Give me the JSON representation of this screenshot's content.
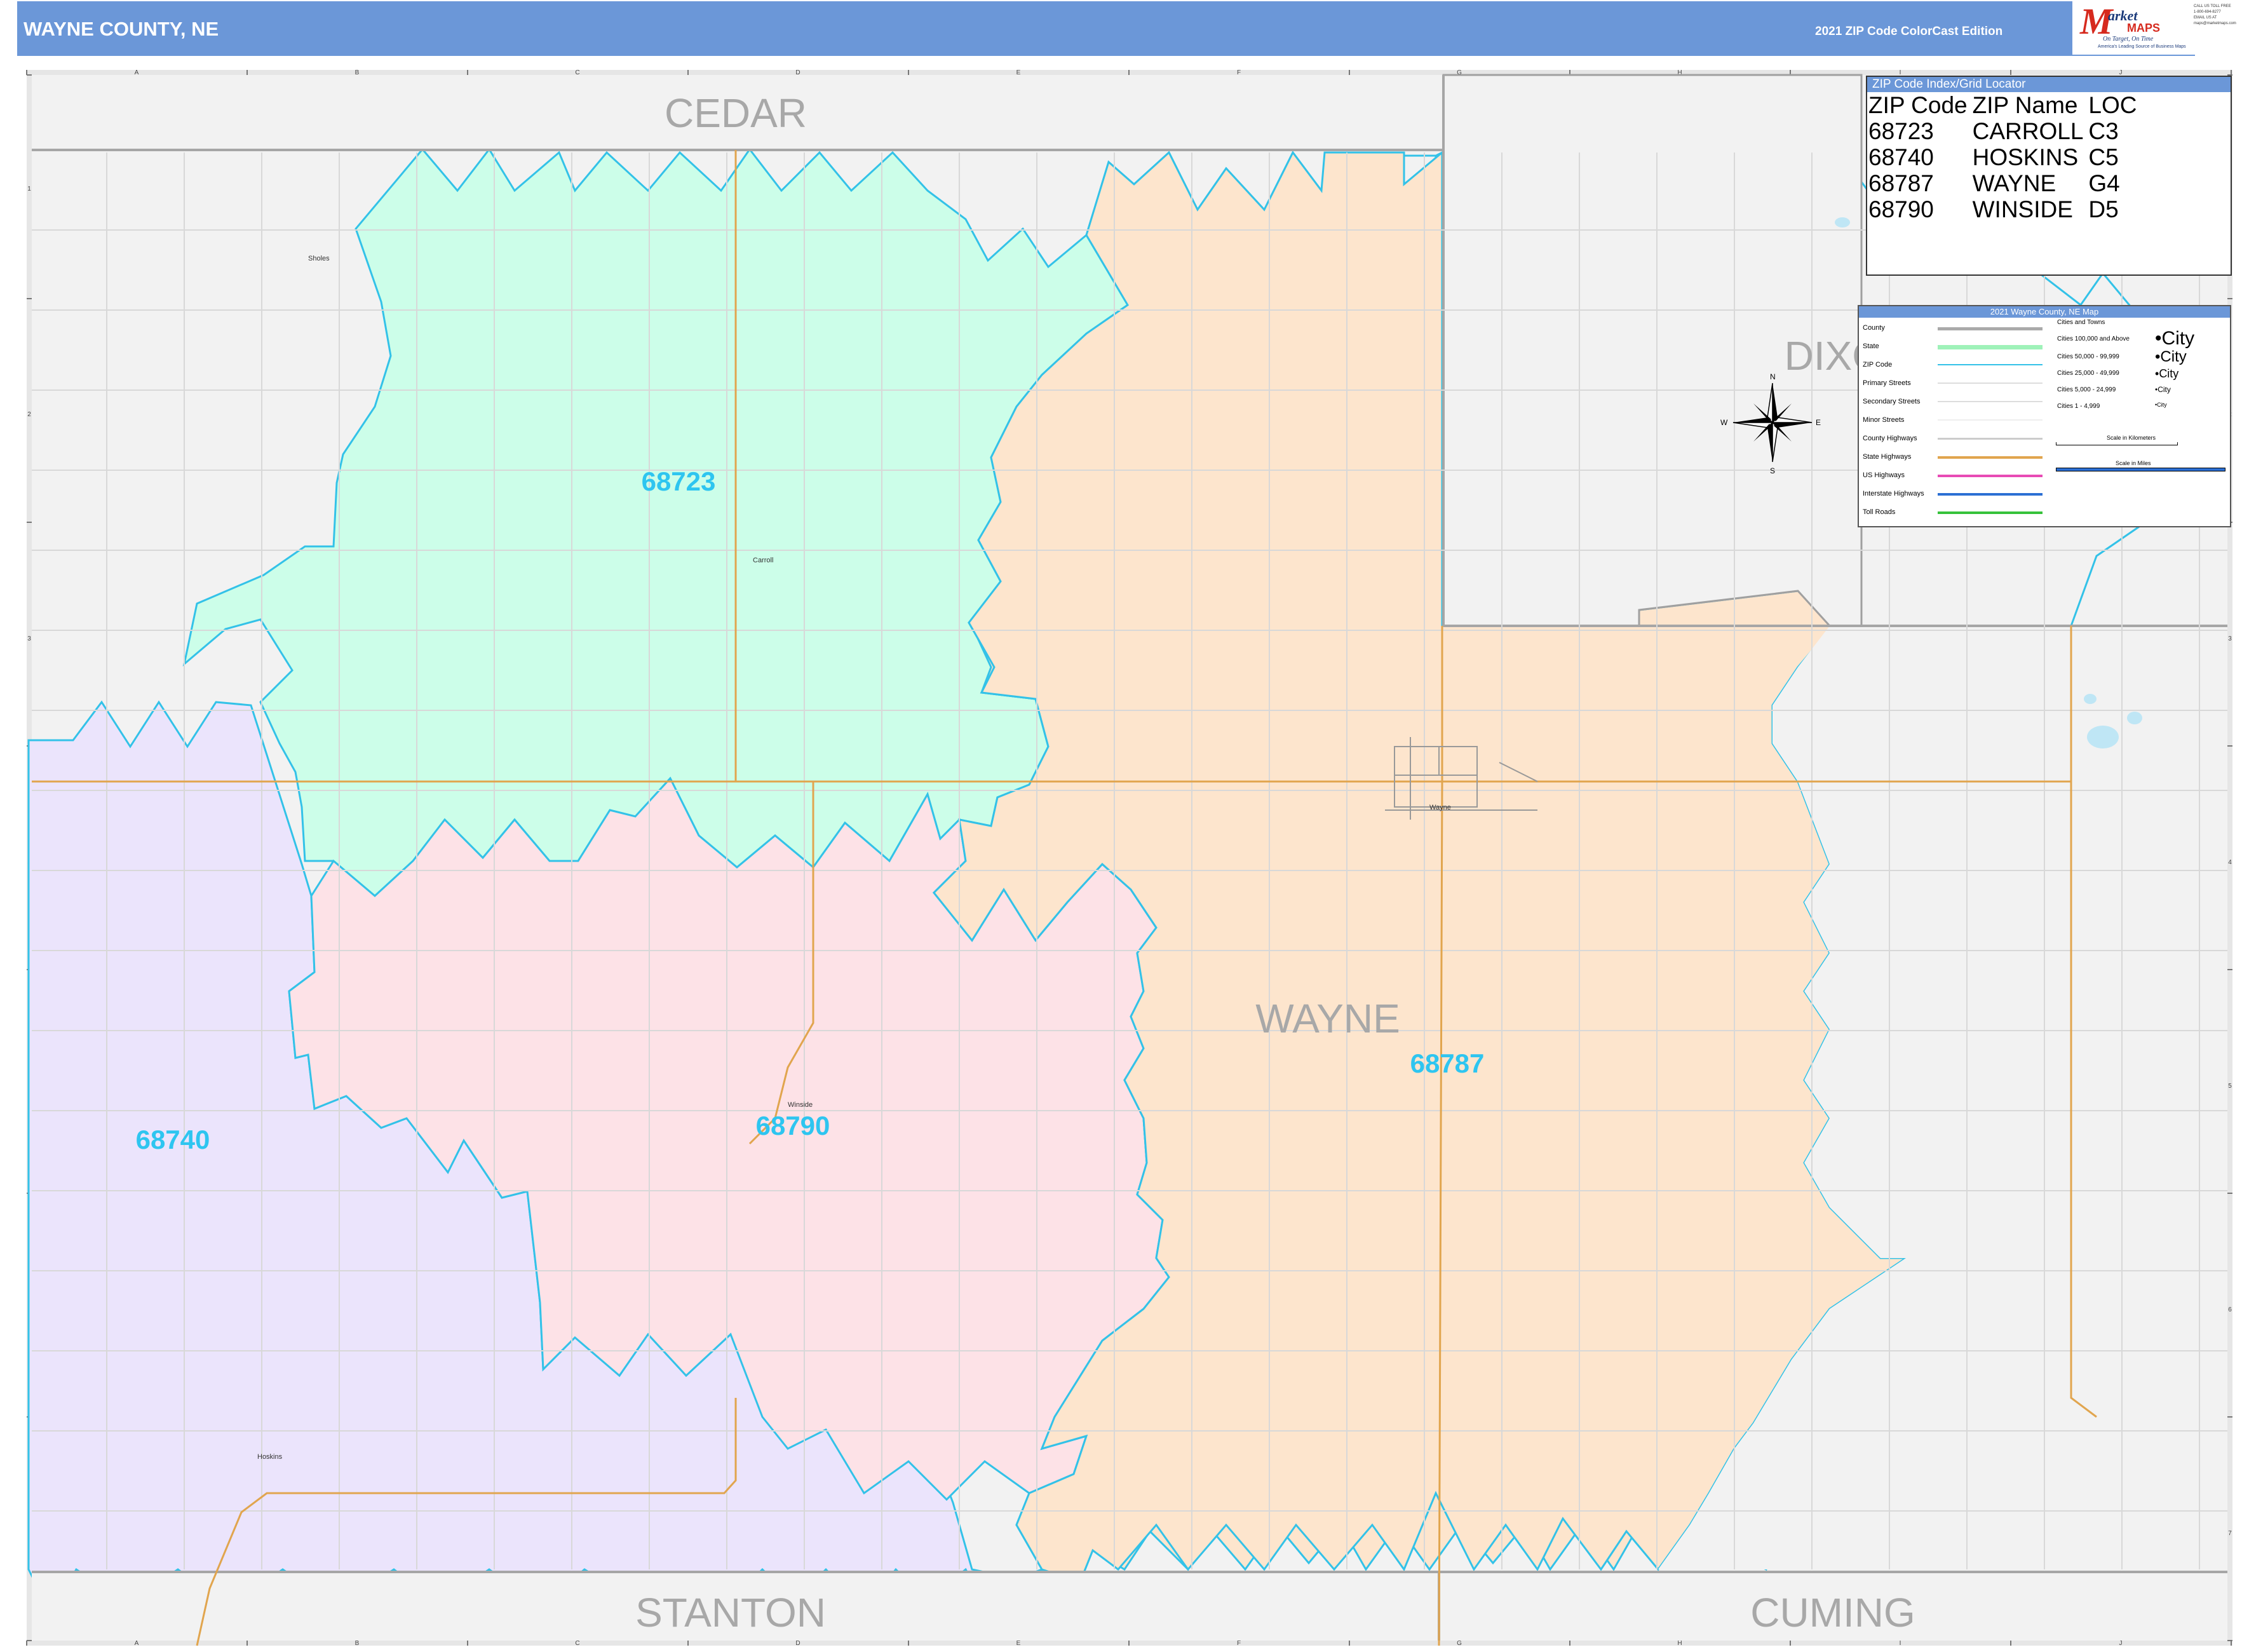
{
  "header": {
    "title": "WAYNE COUNTY, NE",
    "edition": "2021 ZIP Code ColorCast Edition"
  },
  "logo": {
    "m": "M",
    "market": "arket",
    "maps": "MAPS",
    "tagline": "On Target, On Time",
    "sub": "America's Leading Source of Business Maps"
  },
  "contact": {
    "line1": "CALL US TOLL FREE",
    "line2": "1-800-694-8277",
    "line3": "EMAIL US AT",
    "line4": "maps@marketmaps.com"
  },
  "grid": {
    "columns": [
      "A",
      "B",
      "C",
      "D",
      "E",
      "F",
      "G",
      "H",
      "I",
      "J"
    ],
    "rows": [
      "1",
      "2",
      "3",
      "4",
      "5",
      "6",
      "7"
    ]
  },
  "counties": {
    "cedar": "CEDAR",
    "dixon": "DIXON",
    "wayne": "WAYNE",
    "stanton": "STANTON",
    "cuming": "CUMING"
  },
  "zip_labels": {
    "z68723": "68723",
    "z68740": "68740",
    "z68790": "68790",
    "z68787": "68787"
  },
  "places": {
    "sholes": "Sholes",
    "carroll": "Carroll",
    "winside": "Winside",
    "wayne": "Wayne",
    "hoskins": "Hoskins"
  },
  "colors": {
    "z68723": "#ccfee9",
    "z68740": "#ebe4fc",
    "z68790": "#fde2e7",
    "z68787": "#fde5cd",
    "outside": "#f2f2f2",
    "zip_border": "#33c2e8",
    "zip_label": "#2ec5f0",
    "county_label": "#a8a8a8",
    "header": "#6b97d8"
  },
  "zip_index": {
    "heading": "ZIP Code Index/Grid Locator",
    "columns": [
      "ZIP Code",
      "ZIP Name",
      "LOC"
    ],
    "rows": [
      [
        "68723",
        "CARROLL",
        "C3"
      ],
      [
        "68740",
        "HOSKINS",
        "C5"
      ],
      [
        "68787",
        "WAYNE",
        "G4"
      ],
      [
        "68790",
        "WINSIDE",
        "D5"
      ]
    ]
  },
  "legend": {
    "heading": "2021 Wayne County, NE Map",
    "items": [
      "County",
      "State",
      "ZIP Code",
      "Primary Streets",
      "Secondary Streets",
      "Minor Streets",
      "County Highways",
      "State Highways",
      "US Highways",
      "Interstate Highways",
      "Toll Roads"
    ],
    "cities_heading": "Cities and Towns",
    "cities": [
      "Cities 100,000 and Above",
      "Cities 50,000 - 99,999",
      "Cities 25,000 - 49,999",
      "Cities 5,000 - 24,999",
      "Cities 1 - 4,999"
    ],
    "city_label": "City",
    "scale_km": "Scale in Kilometers",
    "scale_mi": "Scale in Miles"
  },
  "compass": {
    "n": "N",
    "s": "S",
    "e": "E",
    "w": "W"
  }
}
